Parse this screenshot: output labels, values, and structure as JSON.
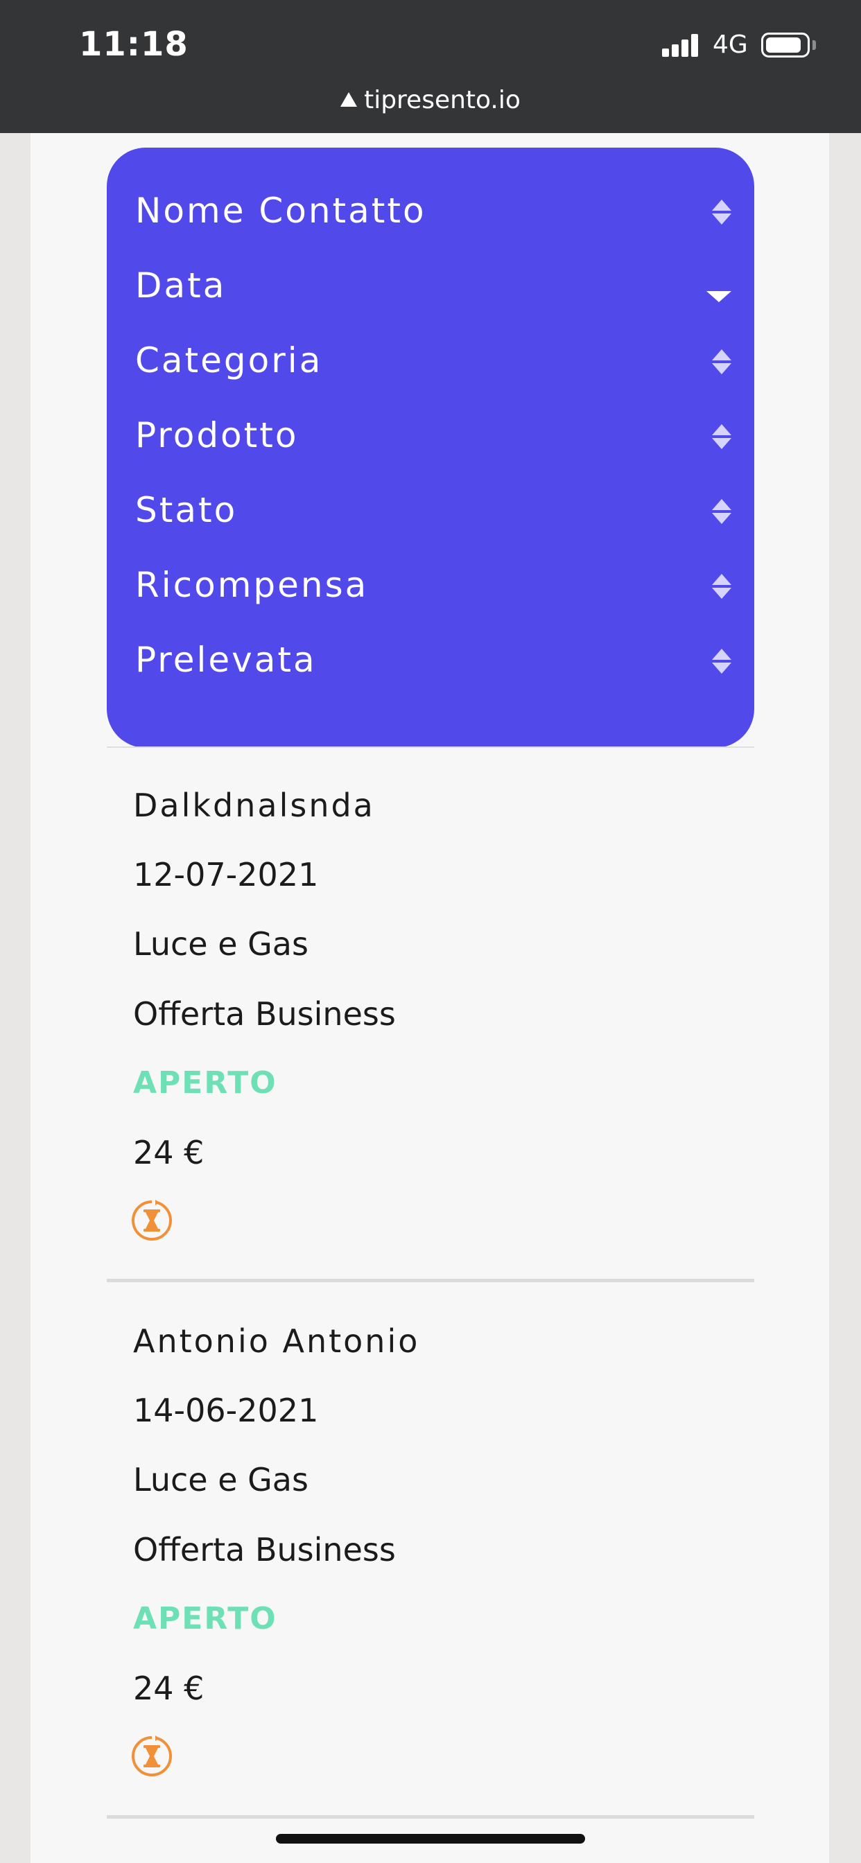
{
  "status_bar": {
    "time": "11:18",
    "network": "4G"
  },
  "browser": {
    "url": "tipresento.io"
  },
  "table_header": {
    "columns": [
      {
        "label": "Nome Contatto",
        "sort": "sortable"
      },
      {
        "label": "Data",
        "sort": "descending"
      },
      {
        "label": "Categoria",
        "sort": "sortable"
      },
      {
        "label": "Prodotto",
        "sort": "sortable"
      },
      {
        "label": "Stato",
        "sort": "sortable"
      },
      {
        "label": "Ricompensa",
        "sort": "sortable"
      },
      {
        "label": "Prelevata",
        "sort": "sortable"
      }
    ]
  },
  "records": [
    {
      "name": "Dalkdnalsnda",
      "date": "12-07-2021",
      "category": "Luce e Gas",
      "product": "Offerta Business",
      "status": "APERTO",
      "reward": "24 €",
      "withdrawn_icon": "hourglass-pending-icon"
    },
    {
      "name": "Antonio Antonio",
      "date": "14-06-2021",
      "category": "Luce e Gas",
      "product": "Offerta Business",
      "status": "APERTO",
      "reward": "24 €",
      "withdrawn_icon": "hourglass-pending-icon"
    }
  ],
  "colors": {
    "header_bg": "#5249eb",
    "status_open": "#6ee0b6",
    "pending_icon": "#f0913a",
    "status_bar_bg": "#343536"
  }
}
